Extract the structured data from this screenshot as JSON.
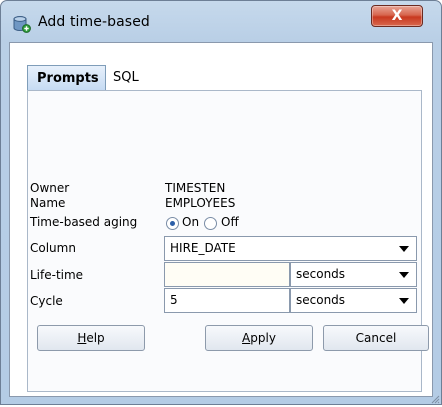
{
  "window": {
    "title": "Add time-based",
    "close_glyph": "X"
  },
  "tabs": [
    {
      "label": "Prompts",
      "active": true
    },
    {
      "label": "SQL",
      "active": false
    }
  ],
  "form": {
    "owner_label": "Owner",
    "owner_value": "TIMESTEN",
    "name_label": "Name",
    "name_value": "EMPLOYEES",
    "aging_label": "Time-based aging",
    "aging_on_label": "On",
    "aging_off_label": "Off",
    "aging_selected": "On",
    "column_label": "Column",
    "column_value": "HIRE_DATE",
    "lifetime_label": "Life-time",
    "lifetime_value": "",
    "lifetime_unit": "seconds",
    "cycle_label": "Cycle",
    "cycle_value": "5",
    "cycle_unit": "seconds"
  },
  "buttons": {
    "help_mnemonic": "H",
    "help_rest": "elp",
    "apply_mnemonic": "A",
    "apply_rest": "pply",
    "cancel": "Cancel"
  },
  "colors": {
    "titlebar": "#b9cfe6",
    "close_button": "#c8381f",
    "active_tab": "#c6dbf3",
    "radio_selected": "#2c5fa8"
  },
  "icons": {
    "app": "database-add-icon",
    "close": "close-icon",
    "dropdown": "chevron-down-icon"
  }
}
